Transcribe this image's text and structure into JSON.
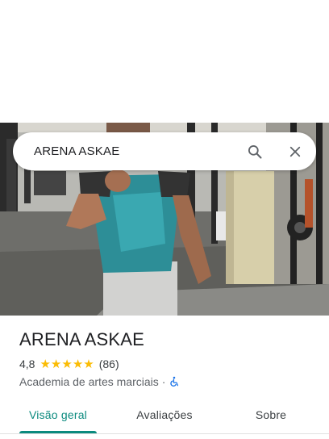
{
  "search": {
    "query": "ARENA ASKAE"
  },
  "place": {
    "name": "ARENA ASKAE",
    "rating": "4,8",
    "rating_value": 4.8,
    "stars_filled": 5,
    "review_count": "(86)",
    "category": "Academia de artes marciais",
    "separator": "·"
  },
  "tabs": [
    {
      "label": "Visão geral",
      "active": true
    },
    {
      "label": "Avaliações",
      "active": false
    },
    {
      "label": "Sobre",
      "active": false
    }
  ],
  "colors": {
    "accent": "#0b8a7e",
    "star": "#fbbc04",
    "wheelchair": "#1a73e8"
  },
  "icons": {
    "search": "search-icon",
    "close": "close-icon",
    "accessibility": "wheelchair-icon"
  }
}
